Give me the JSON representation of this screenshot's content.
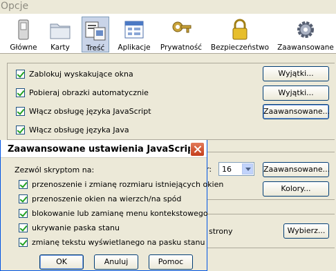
{
  "window": {
    "title": "Opcje"
  },
  "toolbar": {
    "items": [
      {
        "label": "Główne",
        "icon": "switch-icon"
      },
      {
        "label": "Karty",
        "icon": "folder-tabs-icon"
      },
      {
        "label": "Treść",
        "icon": "content-icon",
        "active": true
      },
      {
        "label": "Aplikacje",
        "icon": "applications-icon"
      },
      {
        "label": "Prywatność",
        "icon": "key-icon"
      },
      {
        "label": "Bezpieczeństwo",
        "icon": "padlock-icon"
      },
      {
        "label": "Zaawansowane",
        "icon": "gear-icon"
      }
    ]
  },
  "content": {
    "checkboxes": [
      {
        "label": "Zablokuj wyskakujące okna",
        "checked": true
      },
      {
        "label": "Pobieraj obrazki automatycznie",
        "checked": true
      },
      {
        "label": "Włącz obsługę języka JavaScript",
        "checked": true
      },
      {
        "label": "Włącz obsługę języka Java",
        "checked": true
      }
    ],
    "buttons": {
      "exceptions1": "Wyjątki...",
      "exceptions2": "Wyjątki...",
      "advanced": "Zaawansowane...",
      "advanced2": "Zaawansowane...",
      "colors": "Kolory...",
      "choose": "Wybierz..."
    },
    "font_size_suffix": "r:",
    "font_size_value": "16",
    "pages_text": "strony"
  },
  "dialog": {
    "title": "Zaawansowane ustawienia JavaScriptu",
    "prompt": "Zezwól skryptom na:",
    "options": [
      {
        "label": "przenoszenie i zmianę rozmiaru istniejących okien",
        "checked": true
      },
      {
        "label": "przenoszenie okien na wierzch/na spód",
        "checked": true
      },
      {
        "label": "blokowanie lub zamianę menu kontekstowego",
        "checked": true
      },
      {
        "label": "ukrywanie paska stanu",
        "checked": true
      },
      {
        "label": "zmianę tekstu wyświetlanego na pasku stanu",
        "checked": true
      }
    ],
    "ok": "OK",
    "cancel": "Anuluj",
    "help": "Pomoc"
  },
  "colors": {
    "accent": "#0054e3",
    "check": "#21a121",
    "close": "#c33d1b"
  }
}
